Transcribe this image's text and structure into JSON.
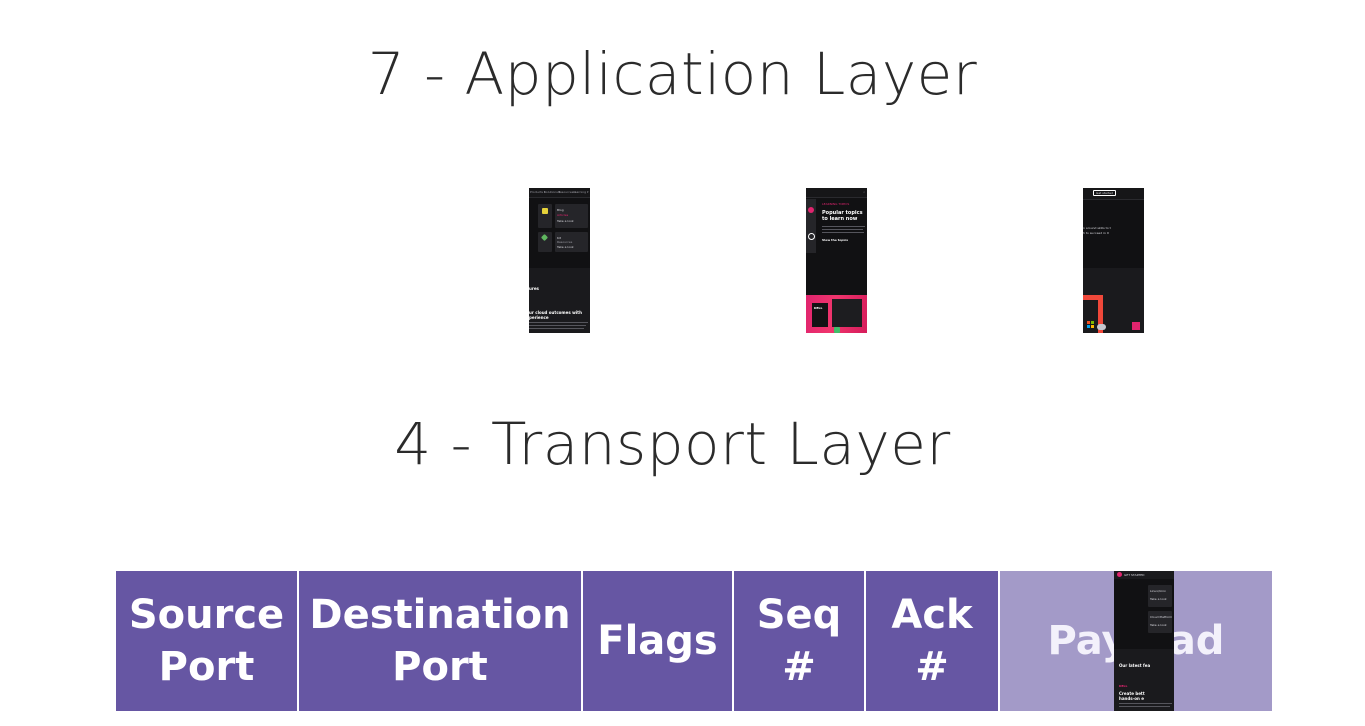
{
  "slide": {
    "application_title": "7 - Application Layer",
    "transport_title": "4 - Transport Layer"
  },
  "thumbnails": [
    {
      "nav_items": [
        "Products ▾",
        "Solutions ▾",
        "Resources ▾",
        "Learning ▾"
      ],
      "cards": [
        {
          "title": "Blog",
          "subtitle": "Articles",
          "link": "Take a look"
        },
        {
          "title": "Kit",
          "subtitle": "Resources",
          "link": "Take a look"
        }
      ],
      "section_label": "ures",
      "headline_line1": "ur cloud outcomes with",
      "headline_line2": "perience"
    },
    {
      "eyebrow": "LEARNING TOPICS",
      "headline_line1": "Popular topics",
      "headline_line2": "to learn now",
      "link": "View the topics",
      "card_label": "DELL"
    },
    {
      "top_button": "Get started",
      "body_text": "n around skills to t",
      "body_text_2": "h to succeed in it"
    }
  ],
  "overlay_thumb": {
    "header_label": "GET STARTED",
    "item1_title": "Linux/Unix",
    "item1_link": "Take a look",
    "item2_title": "Cloud Platform",
    "item2_link": "Take a look",
    "section_label": "Our latest fea",
    "brand": "DELL",
    "headline": "Create bett",
    "headline_2": "hands-on e"
  },
  "transport_header": [
    {
      "label": "Source\nPort"
    },
    {
      "label": "Destination\nPort"
    },
    {
      "label": "Flags"
    },
    {
      "label": "Seq\n#"
    },
    {
      "label": "Ack\n#"
    },
    {
      "label": "Payload"
    }
  ],
  "colors": {
    "header_cell": "#6656a3",
    "payload_cell": "#a39ac8",
    "thumbnail_bg": "#111113",
    "accent_pink": "#e0246e",
    "accent_orange": "#f0483a"
  }
}
